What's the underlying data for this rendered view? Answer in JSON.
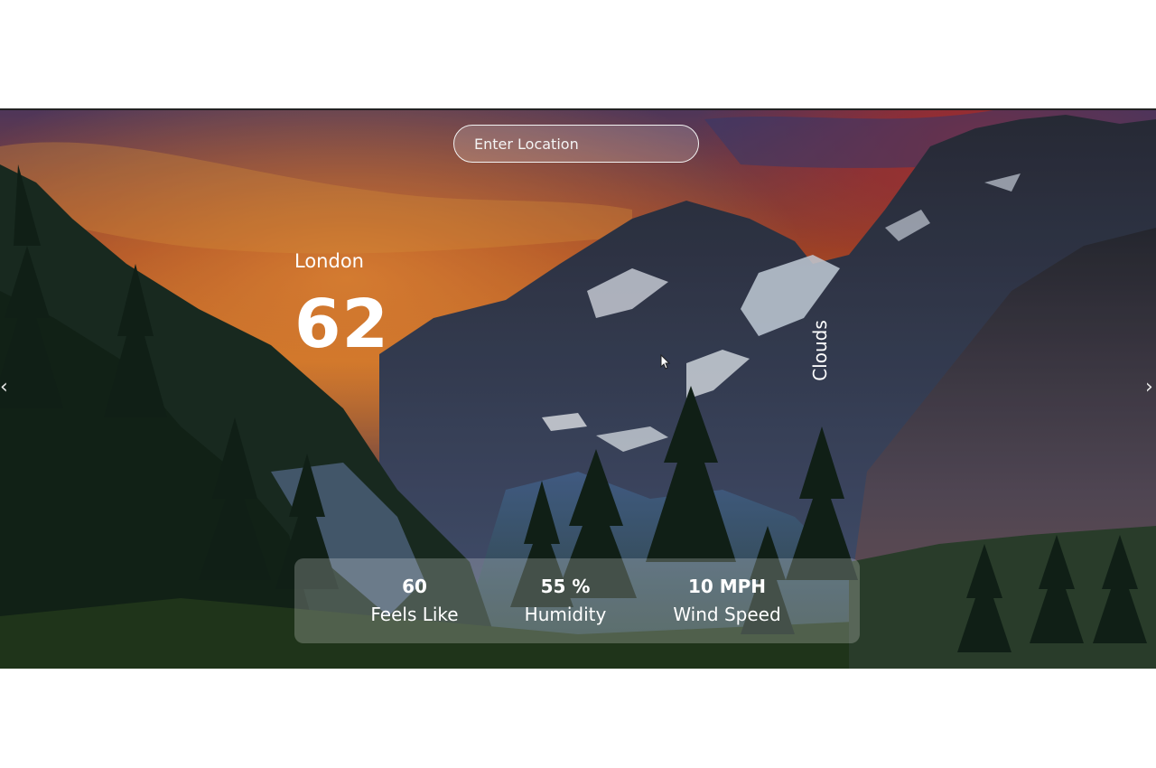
{
  "search": {
    "placeholder": "Enter Location"
  },
  "weather": {
    "city": "London",
    "temperature": "62",
    "description": "Clouds"
  },
  "stats": {
    "feels_like": {
      "value": "60",
      "label": "Feels Like"
    },
    "humidity": {
      "value": "55 %",
      "label": "Humidity"
    },
    "wind": {
      "value": "10 MPH",
      "label": "Wind Speed"
    }
  },
  "nav": {
    "prev_label": "‹",
    "next_label": "›"
  },
  "icons": {
    "prev": "chevron-left-icon",
    "next": "chevron-right-icon",
    "cursor": "mouse-pointer-icon"
  },
  "colors": {
    "text": "#ffffff",
    "panel": "rgba(255,255,255,0.22)",
    "sky_orange": "#e8742a",
    "mountain": "#3d4a66",
    "forest": "#1d3a22"
  }
}
